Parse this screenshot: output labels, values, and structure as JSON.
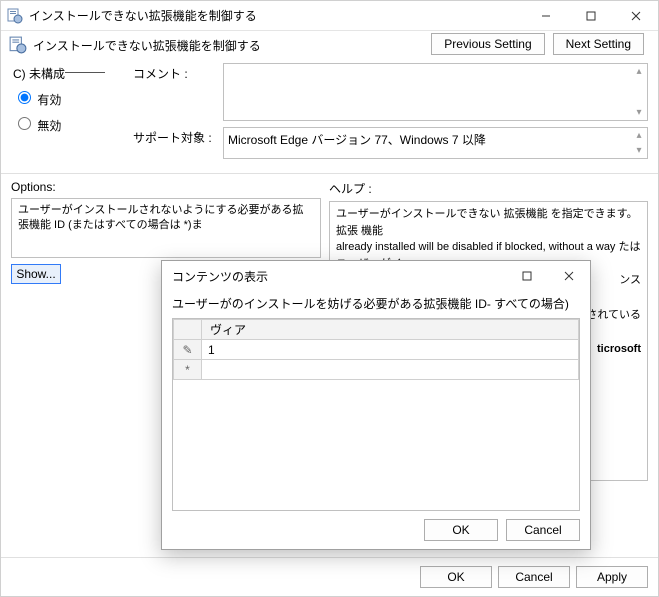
{
  "window": {
    "title": "インストールできない拡張機能を制御する",
    "heading": "インストールできない拡張機能を制御する",
    "prev_button": "Previous Setting",
    "next_button": "Next Setting"
  },
  "radios": {
    "not_configured": "C) 未構成",
    "enabled": "有効",
    "disabled": "無効"
  },
  "labels": {
    "comment": "コメント :",
    "supported": "サポート対象 :",
    "options": "Options:",
    "help": "ヘルプ :"
  },
  "supported_text": "Microsoft Edge バージョン 77、Windows 7 以降",
  "options_text": "ユーザーがインストールされないようにする必要がある拡張機能 ID (またはすべての場合は *)ま",
  "show_button": "Show...",
  "help_text_line1": "ユーザーがインストールできない 拡張機能 を指定できます。拡張 機能",
  "help_text_line2": "already installed will be disabled if blocked, without a way たはユーザーがイ",
  "help_text_line3": "ンス",
  "help_text_line4": "ess トールされている",
  "help_text_line5": "ticrosoft",
  "footer": {
    "ok": "OK",
    "cancel": "Cancel",
    "apply": "Apply"
  },
  "modal": {
    "title": "コンテンツの表示",
    "prompt": "ユーザーがのインストールを妨げる必要がある拡張機能 ID- すべての場合)",
    "col_header": "ヴィア",
    "row1_marker": "✎",
    "row1_value": "1",
    "row2_marker": "*",
    "row2_value": "",
    "ok": "OK",
    "cancel": "Cancel"
  }
}
